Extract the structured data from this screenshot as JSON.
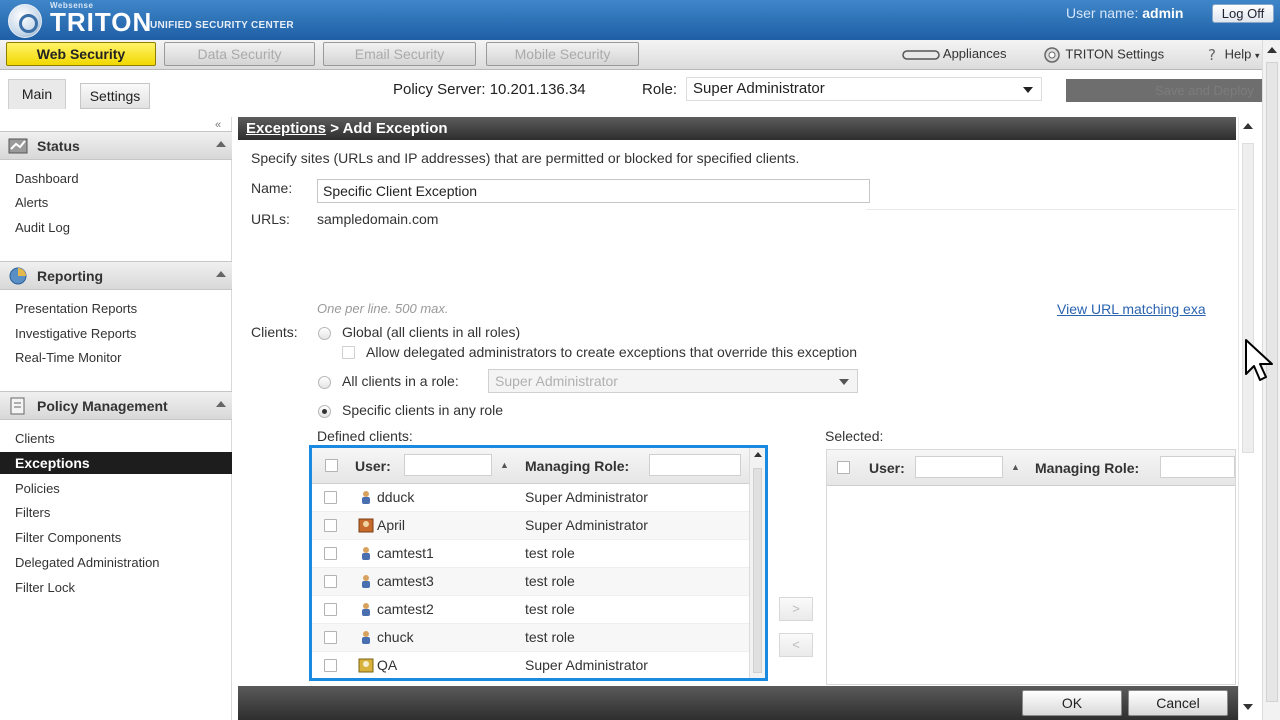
{
  "header": {
    "brand_small": "Websense",
    "brand_name": "TRITON",
    "brand_sub": "UNIFIED SECURITY CENTER",
    "user_label": "User name:",
    "user_name": "admin",
    "logoff_label": "Log Off"
  },
  "modules": {
    "tabs": [
      {
        "label": "Web Security",
        "active": true
      },
      {
        "label": "Data Security",
        "active": false
      },
      {
        "label": "Email Security",
        "active": false
      },
      {
        "label": "Mobile Security",
        "active": false
      }
    ],
    "appliances_label": "Appliances",
    "triton_settings_label": "TRITON Settings",
    "help_label": "Help"
  },
  "subbar": {
    "main_tab": "Main",
    "settings_tab": "Settings",
    "policy_server_label": "Policy Server:",
    "policy_server_value": "10.201.136.34",
    "role_label": "Role:",
    "role_value": "Super Administrator",
    "save_label": "Save and Deploy"
  },
  "sidebar": {
    "sections": [
      {
        "title": "Status",
        "items": [
          "Dashboard",
          "Alerts",
          "Audit Log"
        ]
      },
      {
        "title": "Reporting",
        "items": [
          "Presentation Reports",
          "Investigative Reports",
          "Real-Time Monitor"
        ]
      },
      {
        "title": "Policy Management",
        "items": [
          "Clients",
          "Exceptions",
          "Policies",
          "Filters",
          "Filter Components",
          "Delegated Administration",
          "Filter Lock"
        ]
      }
    ],
    "active_item": "Exceptions"
  },
  "content": {
    "breadcrumb_link": "Exceptions",
    "breadcrumb_current": " > Add Exception",
    "description": "Specify sites (URLs and IP addresses) that are permitted or blocked for specified clients.",
    "name_label": "Name:",
    "name_value": "Specific Client Exception",
    "urls_label": "URLs:",
    "urls_value": "sampledomain.com",
    "urls_hint": "One per line. 500 max.",
    "view_link": "View URL matching exa",
    "clients_label": "Clients:",
    "opt_global": "Global (all clients in all roles)",
    "opt_allow_delegated": "Allow delegated administrators to create exceptions that override this exception",
    "opt_all_in_role": "All clients in a role:",
    "role_dropdown_value": "Super Administrator",
    "opt_specific": "Specific clients in any role",
    "defined_label": "Defined clients:",
    "selected_label": "Selected:",
    "col_user": "User:",
    "col_managing_role": "Managing Role:",
    "clients": [
      {
        "user": "dduck",
        "role": "Super Administrator",
        "type": "user"
      },
      {
        "user": "April",
        "role": "Super Administrator",
        "type": "group"
      },
      {
        "user": "camtest1",
        "role": "test role",
        "type": "user"
      },
      {
        "user": "camtest3",
        "role": "test role",
        "type": "user"
      },
      {
        "user": "camtest2",
        "role": "test role",
        "type": "user"
      },
      {
        "user": "chuck",
        "role": "test role",
        "type": "user"
      },
      {
        "user": "QA",
        "role": "Super Administrator",
        "type": "group"
      }
    ],
    "move_right": ">",
    "move_left": "<",
    "ok_label": "OK",
    "cancel_label": "Cancel"
  },
  "colors": {
    "accent_yellow": "#f1d800",
    "header_blue": "#1f5fa5",
    "highlight_border": "#1a8ae0",
    "link_blue": "#2a63b0"
  }
}
